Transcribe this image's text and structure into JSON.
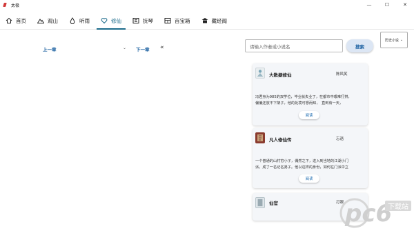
{
  "window": {
    "title": "太极",
    "controls": {
      "minimize": "—",
      "maximize": "☐",
      "close": "✕"
    }
  },
  "tabs": [
    {
      "label": "首页",
      "icon": "home-icon"
    },
    {
      "label": "观山",
      "icon": "mountain-icon"
    },
    {
      "label": "听雨",
      "icon": "raindrop-icon"
    },
    {
      "label": "修仙",
      "icon": "heart-icon",
      "active": true
    },
    {
      "label": "抚琴",
      "icon": "qin-icon"
    },
    {
      "label": "百宝箱",
      "icon": "treasure-box-icon"
    },
    {
      "label": "藏经阁",
      "icon": "pavilion-icon"
    }
  ],
  "reader": {
    "prev": "上一章",
    "next": "下一章",
    "chapter_dropdown": "⌄",
    "collapse": "«"
  },
  "search": {
    "placeholder": "请输入作者或小说名",
    "button": "搜索"
  },
  "filter": {
    "value": "历史小说",
    "chevron": "⌄"
  },
  "books": [
    {
      "name": "大数据修仙",
      "author": "陈风笑",
      "desc": [
        "冯君身为985的双学位，毕业就失业了，在都市中艰难打拼，",
        "偏偏还放不下架子，他的处境可想而知，　直到有一天，"
      ],
      "read": "阅读"
    },
    {
      "name": "凡人修仙传",
      "author": "忘语",
      "desc": [
        "一个普通的山村穷小子，偶然之下，进入到当地的江湖小门",
        "派，成了一名记名弟子。他以这样的身份，如何在门派中立"
      ],
      "read": "阅读"
    },
    {
      "name": "仙官",
      "author": "打眼",
      "desc": [],
      "read": ""
    }
  ],
  "watermark": {
    "brand": "pc6",
    "sub": "下载站"
  },
  "colors": {
    "accent": "#1a6a8a",
    "link": "#1a5fa0",
    "card_bg": "#f4f6f9",
    "button_bg": "#dce6f4"
  }
}
